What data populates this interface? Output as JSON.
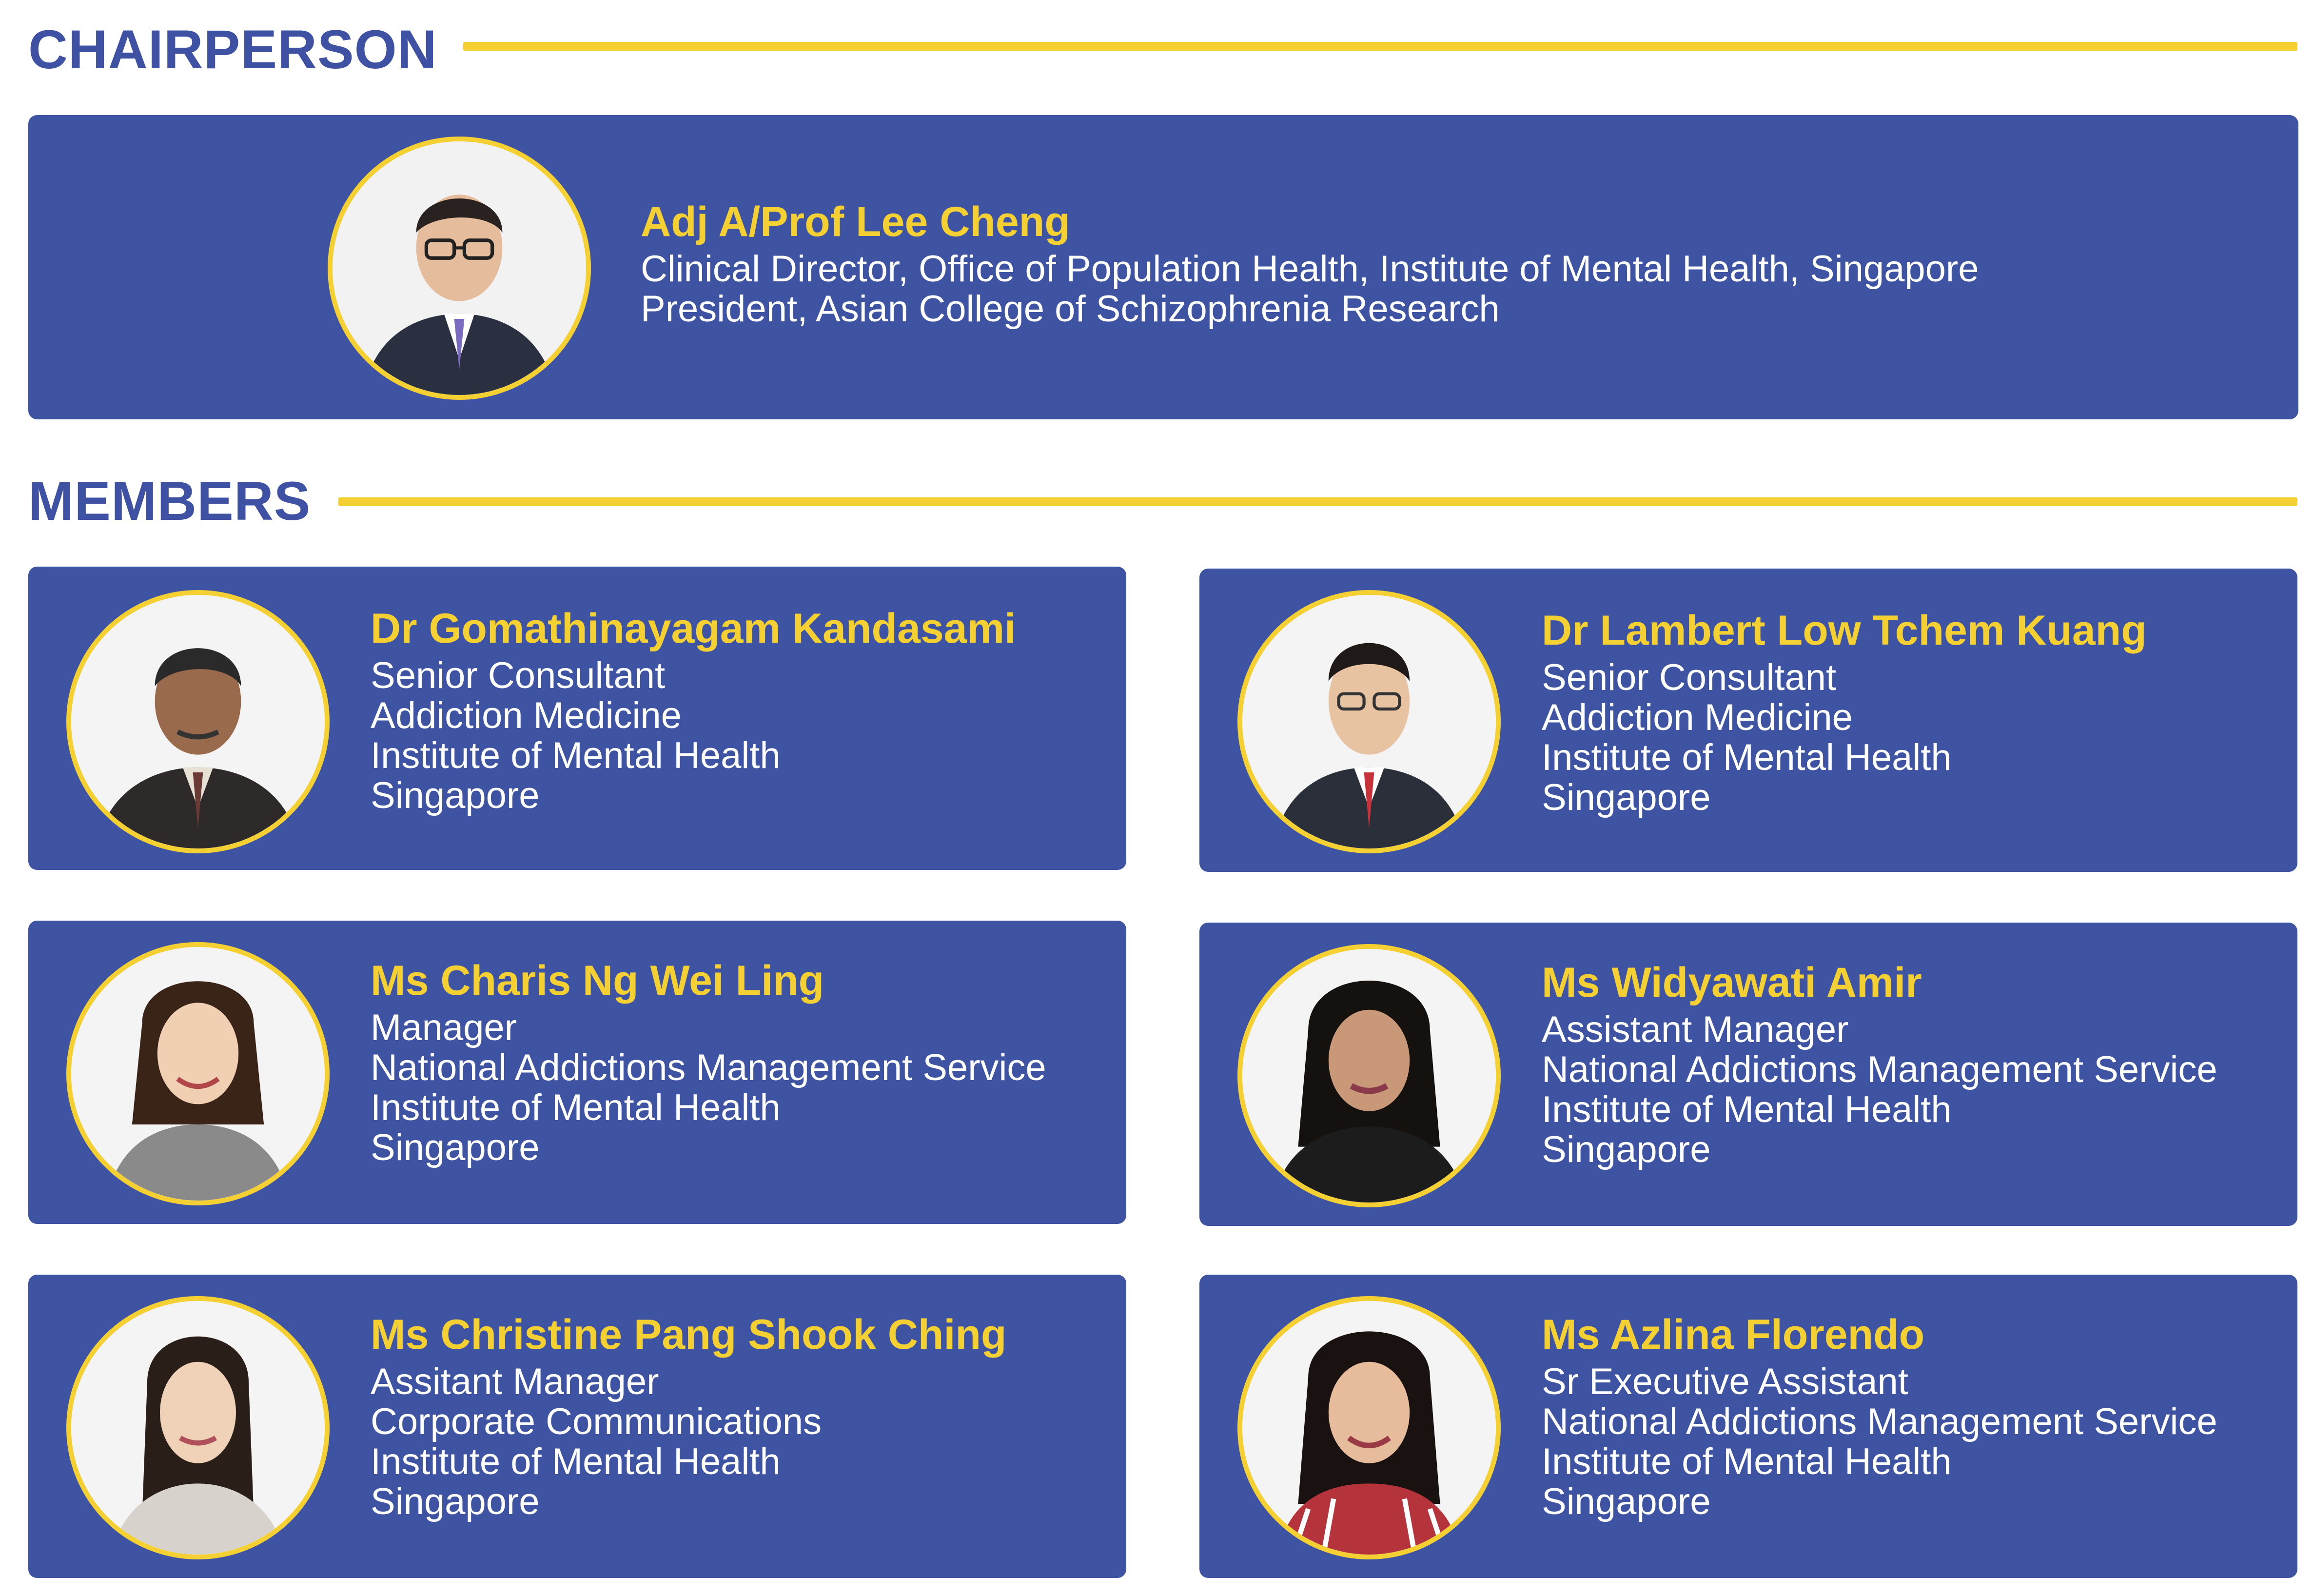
{
  "sections": {
    "chairperson": "CHAIRPERSON",
    "members": "MEMBERS"
  },
  "chair": {
    "name": "Adj A/Prof Lee Cheng",
    "lines": [
      "Clinical Director, Office of Population Health, Institute of Mental Health, Singapore",
      "President, Asian College of Schizophrenia Research"
    ],
    "photo": "person-photo"
  },
  "members": [
    {
      "name": "Dr Gomathinayagam Kandasami",
      "lines": [
        "Senior Consultant",
        "Addiction Medicine",
        "Institute of Mental Health",
        "Singapore"
      ],
      "photo": "person-photo"
    },
    {
      "name": "Dr Lambert Low Tchem Kuang",
      "lines": [
        "Senior Consultant",
        "Addiction Medicine",
        "Institute of Mental Health",
        "Singapore"
      ],
      "photo": "person-photo"
    },
    {
      "name": "Ms Charis Ng Wei Ling",
      "lines": [
        "Manager",
        "National Addictions Management Service",
        "Institute of Mental Health",
        "Singapore"
      ],
      "photo": "person-photo"
    },
    {
      "name": "Ms Widyawati Amir",
      "lines": [
        "Assistant Manager",
        "National Addictions Management Service",
        "Institute of Mental Health",
        "Singapore"
      ],
      "photo": "person-photo"
    },
    {
      "name": "Ms Christine Pang Shook Ching",
      "lines": [
        "Assitant Manager",
        "Corporate Communications",
        "Institute of Mental Health",
        "Singapore"
      ],
      "photo": "person-photo"
    },
    {
      "name": "Ms Azlina Florendo",
      "lines": [
        "Sr Executive Assistant",
        "National Addictions Management Service",
        "Institute of Mental Health",
        "Singapore"
      ],
      "photo": "person-photo"
    }
  ],
  "colors": {
    "heading": "#3f51a3",
    "card": "#3e53a2",
    "accent": "#f5d033",
    "text": "#ffffff"
  }
}
